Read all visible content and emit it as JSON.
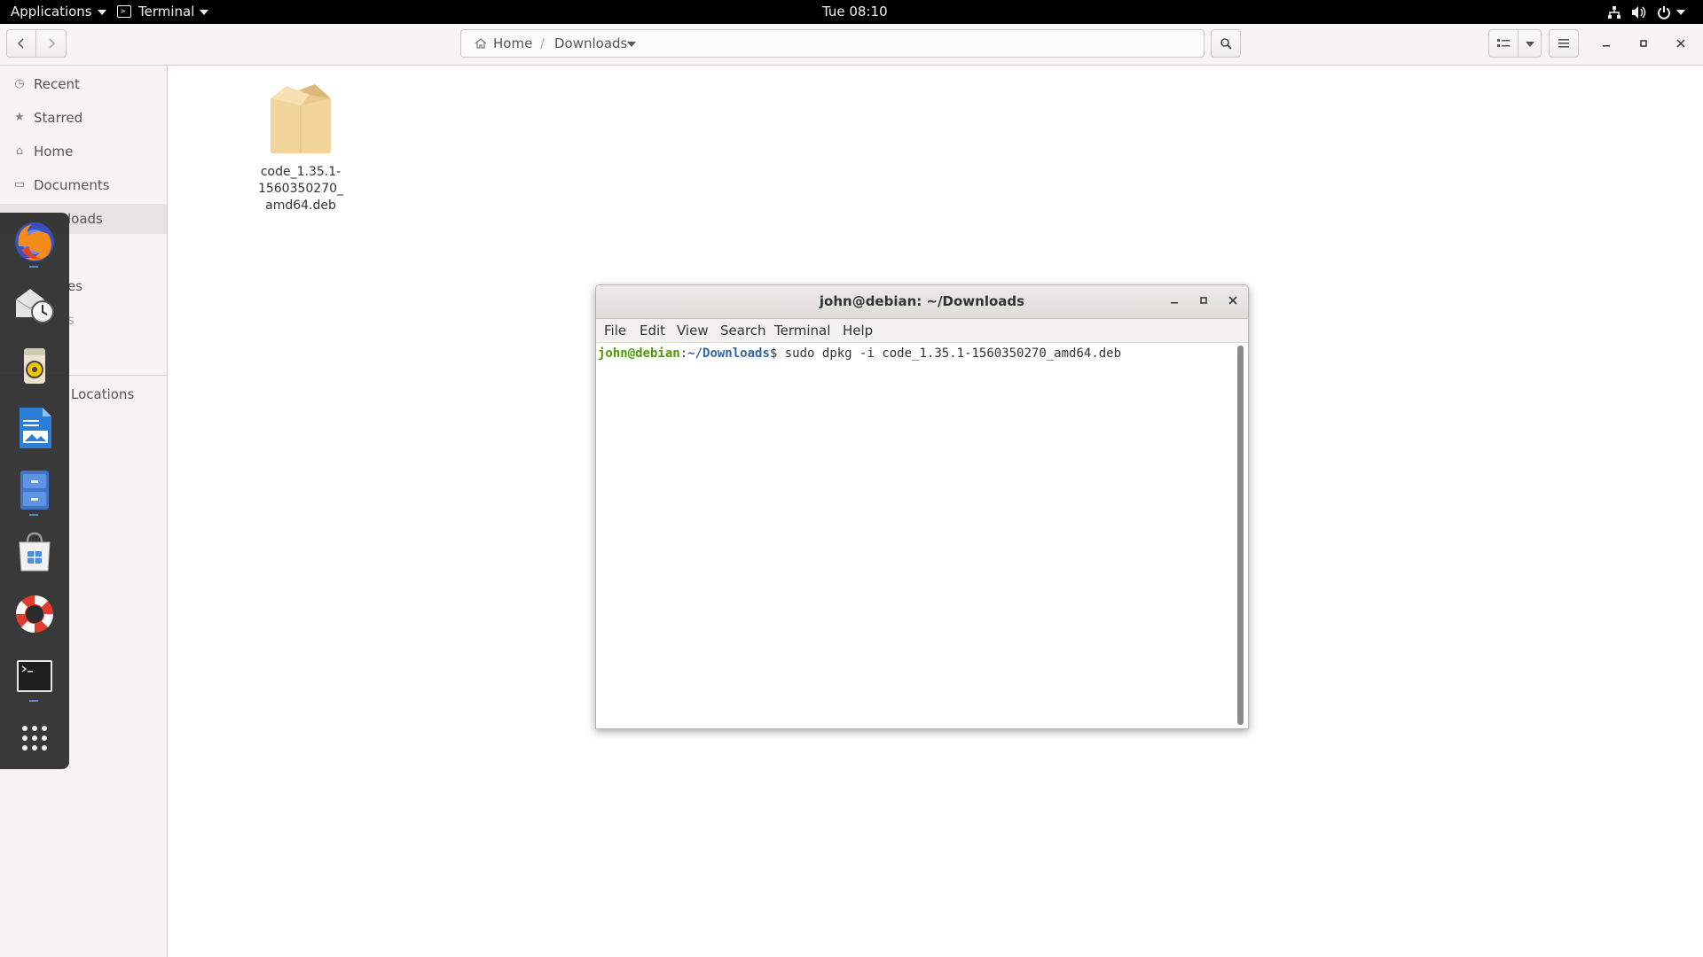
{
  "topbar": {
    "applications_label": "Applications",
    "terminal_label": "Terminal",
    "clock": "Tue 08:10"
  },
  "header": {
    "path_home": "Home",
    "path_separator": "/",
    "path_current": "Downloads"
  },
  "sidebar": {
    "items": [
      {
        "label": "Recent",
        "icon": "clock-icon"
      },
      {
        "label": "Starred",
        "icon": "star-icon"
      },
      {
        "label": "Home",
        "icon": "home-icon"
      },
      {
        "label": "Documents",
        "icon": "document-icon"
      },
      {
        "label": "loads",
        "icon": "download-icon"
      },
      {
        "label": "es",
        "icon": "folder-icon"
      },
      {
        "label": "s",
        "icon": "folder-icon"
      },
      {
        "label": "Locations",
        "icon": "plus-icon"
      }
    ]
  },
  "file": {
    "name": "code_1.35.1-1560350270_amd64.deb",
    "name_line1": "code_1.35.1-",
    "name_line2": "1560350270_",
    "name_line3": "amd64.deb",
    "icon": "package-icon"
  },
  "dock": {
    "apps": [
      "firefox-icon",
      "evolution-icon",
      "rhythmbox-icon",
      "writer-icon",
      "files-icon",
      "software-icon",
      "help-icon",
      "terminal-icon",
      "app-grid-icon"
    ]
  },
  "terminal": {
    "title": "john@debian: ~/Downloads",
    "menu": [
      "File",
      "Edit",
      "View",
      "Search",
      "Terminal",
      "Help"
    ],
    "prompt_user": "john@debian",
    "prompt_colon": ":",
    "prompt_path": "~/Downloads",
    "prompt_symbol": "$",
    "command": " sudo dpkg -i code_1.35.1-1560350270_amd64.deb"
  },
  "colors": {
    "prompt_user": "#4e9a06",
    "prompt_path": "#3465a4",
    "topbar_bg": "#000000",
    "dock_bg": "#282828"
  }
}
